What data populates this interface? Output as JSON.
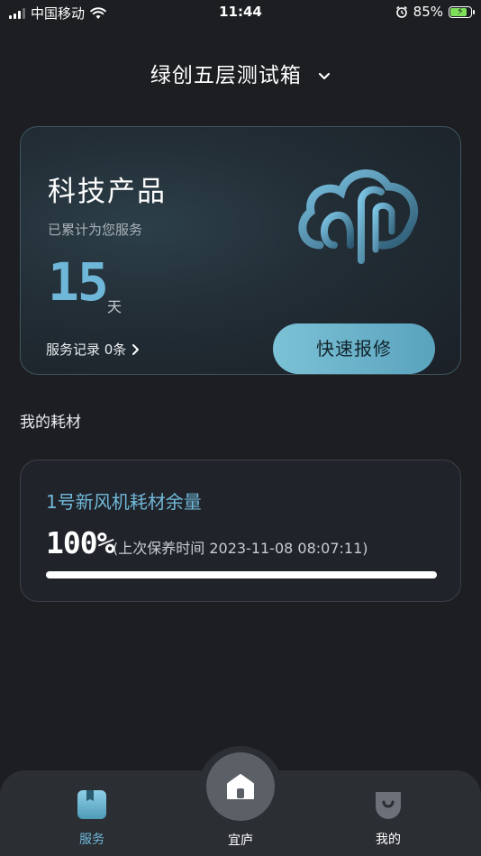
{
  "status_bar": {
    "carrier": "中国移动",
    "time": "11:44",
    "battery_percent": "85%",
    "battery_level": 0.85
  },
  "header": {
    "title": "绿创五层测试箱"
  },
  "product_card": {
    "name": "科技产品",
    "served_label": "已累计为您服务",
    "days": "15",
    "days_unit": "天",
    "records_link": "服务记录 0条",
    "repair_button": "快速报修"
  },
  "consumables": {
    "section_title": "我的耗材",
    "items": [
      {
        "title": "1号新风机耗材余量",
        "percent": "100%",
        "level": 1.0,
        "last_maintenance": "(上次保养时间 2023-11-08 08:07:11)"
      }
    ]
  },
  "tab_bar": {
    "items": [
      {
        "label": "服务",
        "icon": "service-box-icon",
        "active": true
      },
      {
        "label": "宜庐",
        "icon": "home-icon",
        "active": false
      },
      {
        "label": "我的",
        "icon": "profile-icon",
        "active": false
      }
    ]
  },
  "colors": {
    "accent": "#6fb7d8",
    "background": "#1c1e22",
    "button_gradient_start": "#7cc2d6",
    "button_gradient_end": "#5aa3bd"
  }
}
